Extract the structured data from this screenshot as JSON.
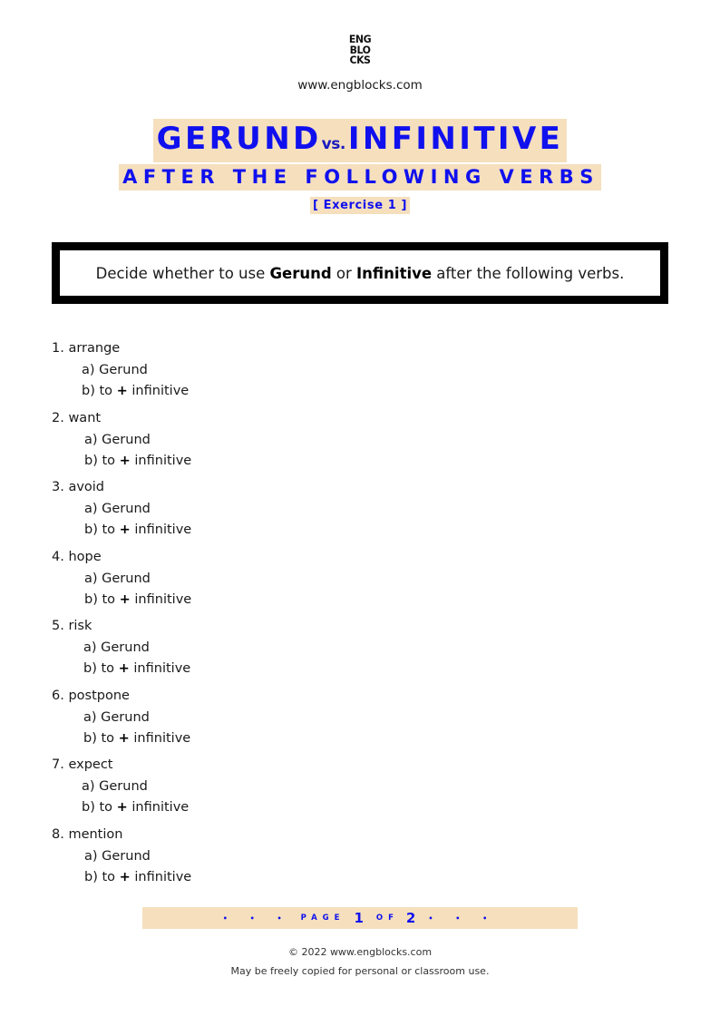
{
  "header": {
    "logo_lines": [
      "ENG",
      "BLO",
      "CKS"
    ],
    "site_url": "www.engblocks.com"
  },
  "title": {
    "word1": "GERUND",
    "vs": "vs.",
    "word2": "INFINITIVE",
    "subtitle": "AFTER THE FOLLOWING VERBS",
    "exercise": "[ Exercise 1 ]"
  },
  "instruction": {
    "prefix": "Decide whether to use ",
    "bold1": "Gerund",
    "middle": " or ",
    "bold2": "Infinitive",
    "suffix": " after the following verbs."
  },
  "questions": [
    {
      "label": "1. arrange",
      "option_a": "a) Gerund",
      "option_b_prefix": "b) to ",
      "plus": "+",
      "option_b_suffix": " infinitive"
    },
    {
      "label": "2. want",
      "option_a": "a) Gerund",
      "option_b_prefix": "b) to ",
      "plus": "+",
      "option_b_suffix": " infinitive"
    },
    {
      "label": "3. avoid",
      "option_a": "a) Gerund",
      "option_b_prefix": "b) to ",
      "plus": "+",
      "option_b_suffix": " infinitive"
    },
    {
      "label": "4. hope",
      "option_a": "a) Gerund",
      "option_b_prefix": "b) to ",
      "plus": "+",
      "option_b_suffix": " infinitive"
    },
    {
      "label": "5. risk",
      "option_a": "a) Gerund",
      "option_b_prefix": "b) to ",
      "plus": "+",
      "option_b_suffix": " infinitive"
    },
    {
      "label": "6. postpone",
      "option_a": "a) Gerund",
      "option_b_prefix": "b) to ",
      "plus": "+",
      "option_b_suffix": " infinitive"
    },
    {
      "label": "7. expect",
      "option_a": "a) Gerund",
      "option_b_prefix": "b) to ",
      "plus": "+",
      "option_b_suffix": " infinitive"
    },
    {
      "label": "8. mention",
      "option_a": "a) Gerund",
      "option_b_prefix": "b) to ",
      "plus": "+",
      "option_b_suffix": " infinitive"
    }
  ],
  "pagination": {
    "dots_left": "• • •",
    "page_label": "PAGE",
    "current": "1",
    "of_label": "OF",
    "total": "2",
    "dots_right": "• • •"
  },
  "footer": {
    "copyright": "© 2022 www.engblocks.com",
    "note": "May be freely copied for personal or classroom use."
  },
  "colors": {
    "accent_blue": "#1010ee",
    "highlight": "#f5dfbd",
    "border": "#000000"
  }
}
